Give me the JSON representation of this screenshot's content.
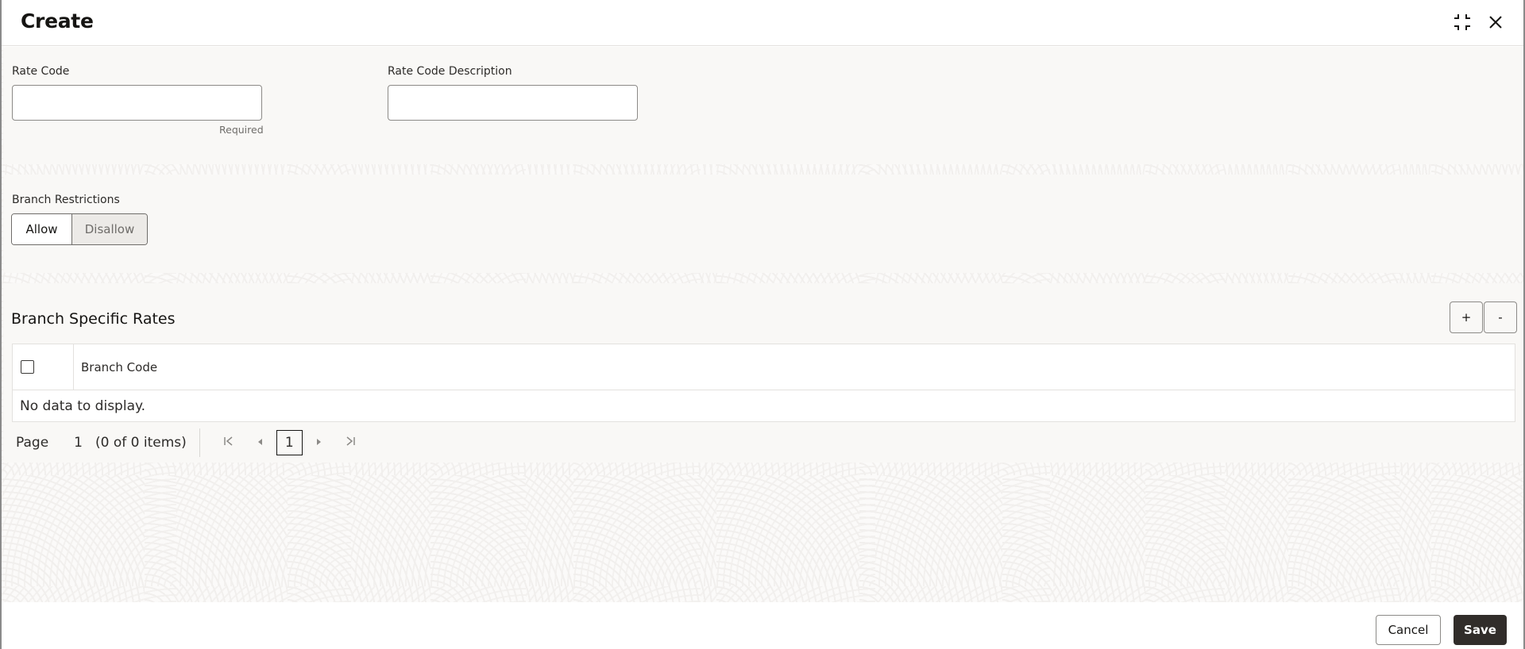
{
  "dialog": {
    "title": "Create",
    "icons": {
      "compress": "compress-icon",
      "close": "close-icon"
    }
  },
  "form": {
    "rate_code": {
      "label": "Rate Code",
      "value": "",
      "placeholder": "",
      "help": "Required"
    },
    "rate_code_description": {
      "label": "Rate Code Description",
      "value": "",
      "placeholder": ""
    }
  },
  "branch_restrictions": {
    "label": "Branch Restrictions",
    "options": [
      "Allow",
      "Disallow"
    ],
    "selected": "Allow"
  },
  "branch_specific_rates": {
    "title": "Branch Specific Rates",
    "add_label": "+",
    "remove_label": "-",
    "columns": [
      "Branch Code"
    ],
    "rows": [],
    "empty_text": "No data to display."
  },
  "pagination": {
    "page_label": "Page",
    "page_value": "1",
    "count_text": "(0 of 0 items)",
    "current_page": "1"
  },
  "footer": {
    "cancel_label": "Cancel",
    "save_label": "Save"
  },
  "colors": {
    "primary_button": "#312d2a",
    "panel_bg": "#f9f8f6"
  }
}
